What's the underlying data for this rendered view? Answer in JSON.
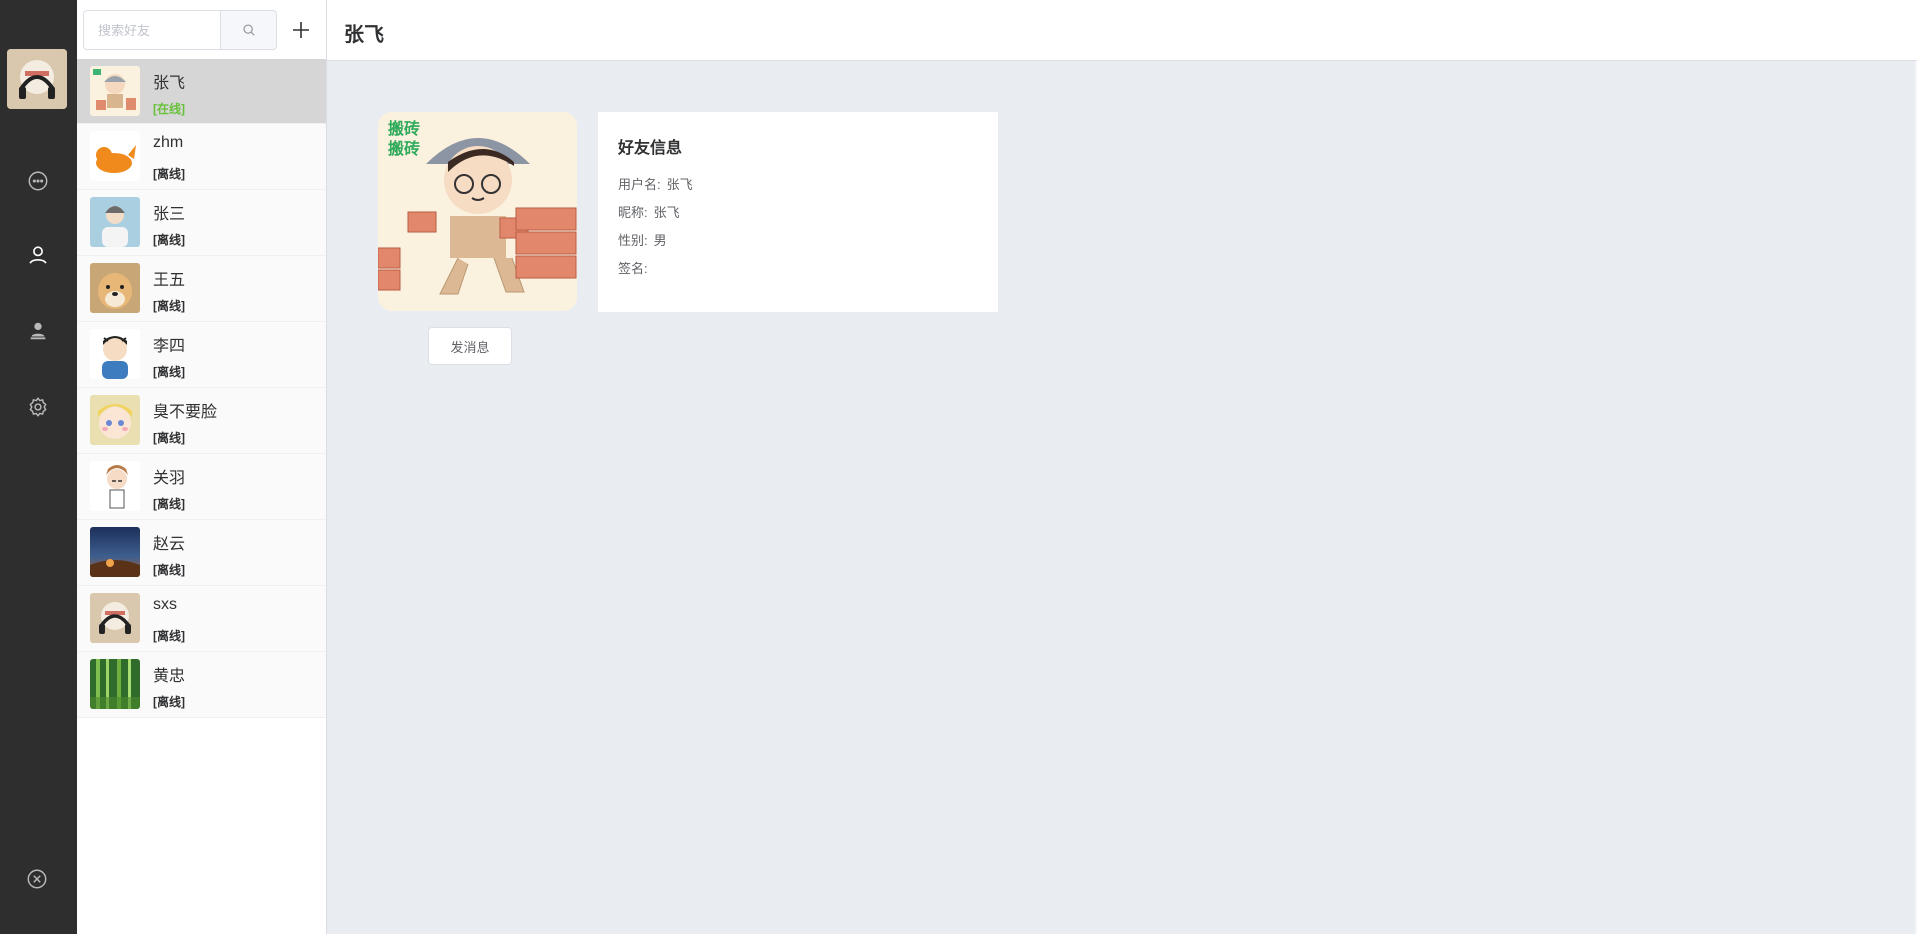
{
  "sidebar_rail": {
    "icons": [
      "chat-icon",
      "contacts-icon",
      "user-stamp-icon",
      "settings-icon",
      "close-icon"
    ]
  },
  "search": {
    "placeholder": "搜索好友",
    "value": ""
  },
  "friends": [
    {
      "name": "张飞",
      "status": "[在线]",
      "active": true
    },
    {
      "name": "zhm",
      "status": "[离线]"
    },
    {
      "name": "张三",
      "status": "[离线]"
    },
    {
      "name": "王五",
      "status": "[离线]"
    },
    {
      "name": "李四",
      "status": "[离线]"
    },
    {
      "name": "臭不要脸",
      "status": "[离线]"
    },
    {
      "name": "关羽",
      "status": "[离线]"
    },
    {
      "name": "赵云",
      "status": "[离线]"
    },
    {
      "name": "sxs",
      "status": "[离线]"
    },
    {
      "name": "黄忠",
      "status": "[离线]"
    }
  ],
  "header": {
    "title": "张飞"
  },
  "detail": {
    "avatar_text": "搬砖\n搬砖",
    "card_title": "好友信息",
    "rows": [
      {
        "label": "用户名:",
        "value": "张飞"
      },
      {
        "label": "昵称:",
        "value": "张飞"
      },
      {
        "label": "性别:",
        "value": "男"
      },
      {
        "label": "签名:",
        "value": ""
      }
    ],
    "send_button": "发消息"
  },
  "colors": {
    "rail_bg": "#2e2e2e",
    "online": "#67c23a",
    "main_bg": "#e9edf1"
  }
}
